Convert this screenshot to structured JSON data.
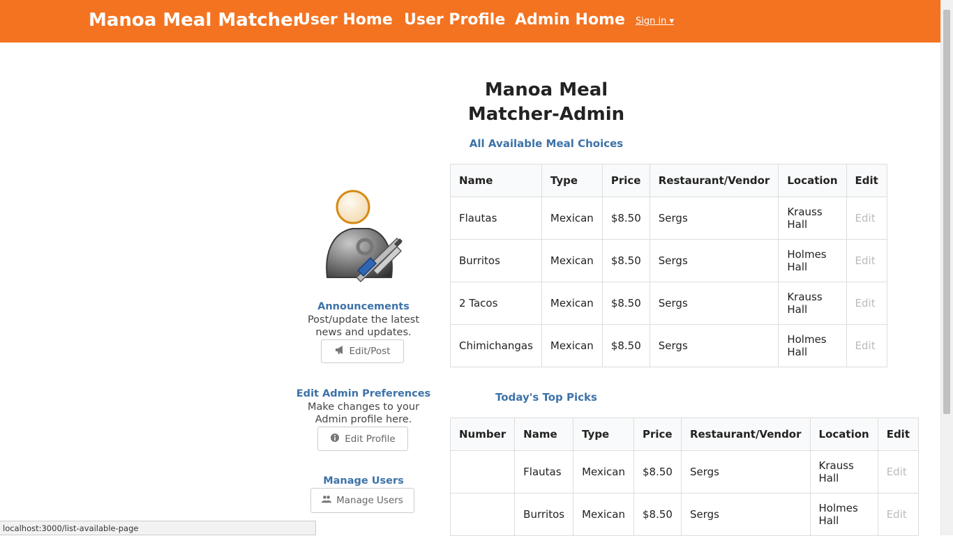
{
  "navbar": {
    "brand": "Manoa Meal Matcher",
    "links": [
      "User Home",
      "User Profile",
      "Admin Home"
    ],
    "signin": "Sign in ▾"
  },
  "main": {
    "title_line1": "Manoa Meal",
    "title_line2": "Matcher-Admin",
    "available_title": "All Available Meal Choices",
    "top_picks_title": "Today's Top Picks"
  },
  "sidebar": {
    "announcements": {
      "title": "Announcements",
      "desc_line1": "Post/update the latest",
      "desc_line2": "news and updates.",
      "button": "Edit/Post",
      "icon": "bullhorn-icon"
    },
    "preferences": {
      "title": "Edit Admin Preferences",
      "desc_line1": "Make changes to your",
      "desc_line2": "Admin profile here.",
      "button": "Edit Profile",
      "icon": "info-circle-icon"
    },
    "manage_users": {
      "title": "Manage Users",
      "button": "Manage Users",
      "icon": "users-icon"
    }
  },
  "available_table": {
    "headers": [
      "Name",
      "Type",
      "Price",
      "Restaurant/Vendor",
      "Location",
      "Edit"
    ],
    "rows": [
      {
        "name": "Flautas",
        "type": "Mexican",
        "price": "$8.50",
        "vendor": "Sergs",
        "loc1": "Krauss",
        "loc2": "Hall",
        "edit": "Edit"
      },
      {
        "name": "Burritos",
        "type": "Mexican",
        "price": "$8.50",
        "vendor": "Sergs",
        "loc1": "Holmes",
        "loc2": "Hall",
        "edit": "Edit"
      },
      {
        "name": "2 Tacos",
        "type": "Mexican",
        "price": "$8.50",
        "vendor": "Sergs",
        "loc1": "Krauss",
        "loc2": "Hall",
        "edit": "Edit"
      },
      {
        "name": "Chimichangas",
        "type": "Mexican",
        "price": "$8.50",
        "vendor": "Sergs",
        "loc1": "Holmes",
        "loc2": "Hall",
        "edit": "Edit"
      }
    ]
  },
  "top_picks_table": {
    "headers": [
      "Number",
      "Name",
      "Type",
      "Price",
      "Restaurant/Vendor",
      "Location",
      "Edit"
    ],
    "rows": [
      {
        "number": "",
        "name": "Flautas",
        "type": "Mexican",
        "price": "$8.50",
        "vendor": "Sergs",
        "loc1": "Krauss",
        "loc2": "Hall",
        "edit": "Edit"
      },
      {
        "number": "",
        "name": "Burritos",
        "type": "Mexican",
        "price": "$8.50",
        "vendor": "Sergs",
        "loc1": "Holmes",
        "loc2": "Hall",
        "edit": "Edit"
      }
    ]
  },
  "statusbar": {
    "url": "localhost:3000/list-available-page"
  },
  "colors": {
    "navbar": "#f47321",
    "heading_blue": "#3d72a8",
    "edit_disabled": "#bbbbbb"
  }
}
